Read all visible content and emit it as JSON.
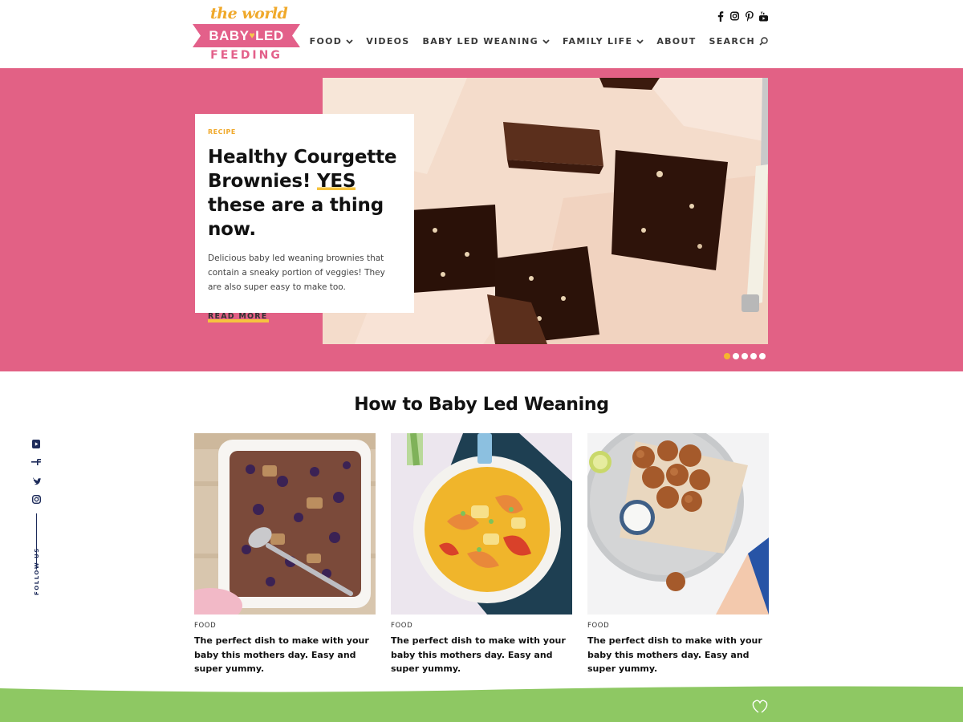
{
  "brand": {
    "logo_top": "the world of",
    "logo_middle_left": "BABY",
    "logo_middle_right": "LED",
    "logo_bottom": "FEEDING"
  },
  "social_top": [
    "facebook-icon",
    "instagram-icon",
    "pinterest-icon",
    "youtube-icon"
  ],
  "nav": {
    "items": [
      {
        "label": "FOOD",
        "has_dropdown": true
      },
      {
        "label": "VIDEOS",
        "has_dropdown": false
      },
      {
        "label": "BABY LED WEANING",
        "has_dropdown": true
      },
      {
        "label": "FAMILY LIFE",
        "has_dropdown": true
      },
      {
        "label": "ABOUT",
        "has_dropdown": false
      },
      {
        "label": "SEARCH",
        "has_dropdown": false
      }
    ]
  },
  "hero": {
    "tag": "RECIPE",
    "title_part1": "Healthy Courgette Brownies! ",
    "title_highlight": "YES",
    "title_part2": " these are a thing now.",
    "description": "Delicious baby led weaning brownies that contain a sneaky portion of veggies! They are also super easy to make too.",
    "read_more": "READ MORE",
    "slides_total": 5,
    "slide_active": 1,
    "background_color": "#e26185"
  },
  "section": {
    "title": "How to Baby Led Weaning"
  },
  "follow": {
    "label": "FOLLOW US",
    "icons": [
      "youtube-icon",
      "facebook-icon",
      "twitter-icon",
      "instagram-icon"
    ]
  },
  "cards": [
    {
      "tag": "FOOD",
      "title": "The perfect dish to make with your baby this mothers day. Easy and super yummy."
    },
    {
      "tag": "FOOD",
      "title": "The perfect dish to make with your baby this mothers day. Easy and super yummy."
    },
    {
      "tag": "FOOD",
      "title": "The perfect dish to make with your baby this mothers day. Easy and super yummy."
    }
  ],
  "colors": {
    "accent_pink": "#e26185",
    "accent_yellow": "#f6b62e",
    "footer_green": "#8ec863",
    "navy": "#1d2b5a"
  }
}
